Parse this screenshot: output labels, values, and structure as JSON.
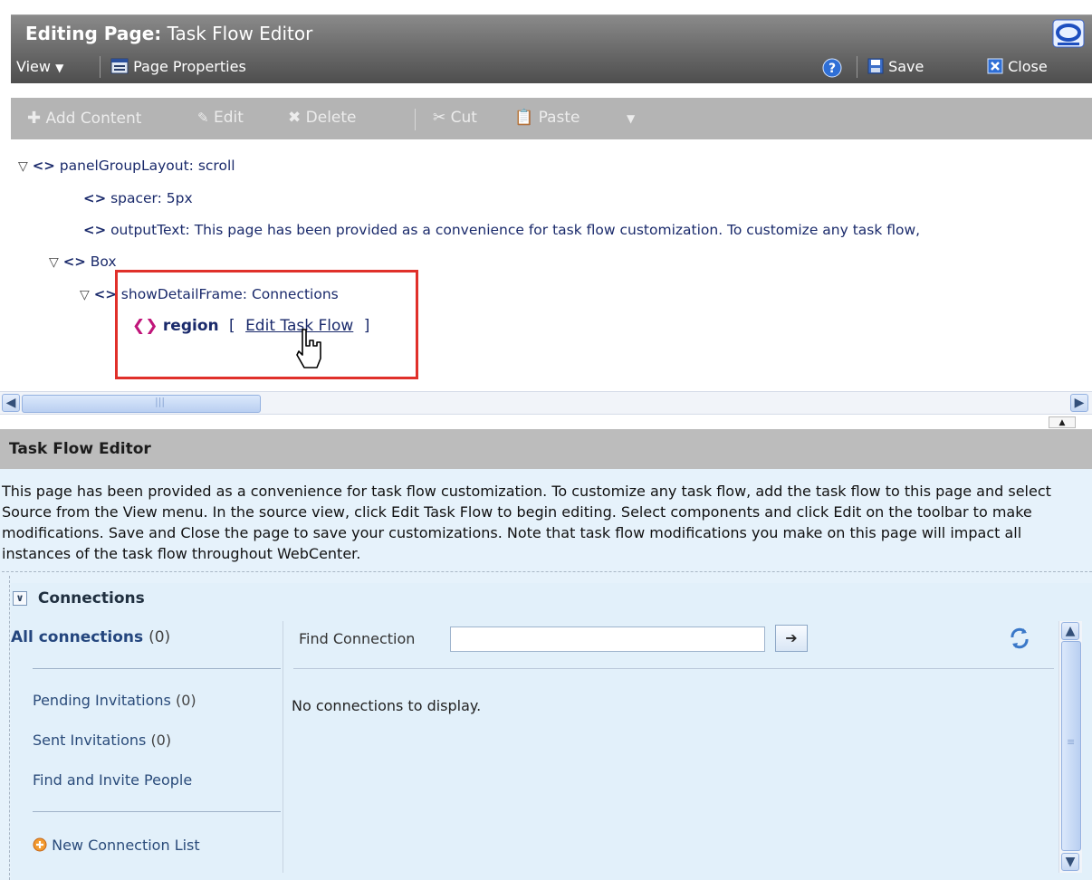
{
  "header": {
    "title_prefix": "Editing Page:",
    "title_name": "Task Flow Editor",
    "logo_icon": "oracle-o-logo"
  },
  "menubar": {
    "view_label": "View",
    "page_properties_label": "Page Properties",
    "save_label": "Save",
    "close_label": "Close"
  },
  "toolbar": {
    "add_content": "Add Content",
    "edit": "Edit",
    "delete": "Delete",
    "cut": "Cut",
    "paste": "Paste"
  },
  "tree": {
    "panel_group": "panelGroupLayout: scroll",
    "spacer": "spacer: 5px",
    "output_text": "outputText: This page has been provided as a convenience for task flow customization. To customize any task flow,",
    "box": "Box",
    "show_detail": "showDetailFrame: Connections",
    "region_label": "region",
    "bracket_open": "[",
    "edit_task_flow": "Edit Task Flow",
    "bracket_close": "]"
  },
  "section": {
    "title": "Task Flow Editor",
    "description": "This page has been provided as a convenience for task flow customization. To customize any task flow, add the task flow to this page and select Source from the View menu. In the source view, click Edit Task Flow to begin editing. Select components and click Edit on the toolbar to make modifications. Save and Close the page to save your customizations. Note that task flow modifications you make on this page will impact all instances of the task flow throughout WebCenter."
  },
  "connections": {
    "header": "Connections",
    "all_connections": "All connections",
    "all_count": "(0)",
    "pending": "Pending Invitations",
    "pending_count": "(0)",
    "sent": "Sent Invitations",
    "sent_count": "(0)",
    "find_invite": "Find and Invite People",
    "new_list": "New Connection List",
    "find_label": "Find Connection",
    "find_value": "",
    "empty_message": "No connections to display."
  },
  "colors": {
    "highlight_box": "#e0302a",
    "link": "#1a2a6b",
    "region_icon": "#c0157a",
    "panel_bg": "#e6f2fb"
  }
}
